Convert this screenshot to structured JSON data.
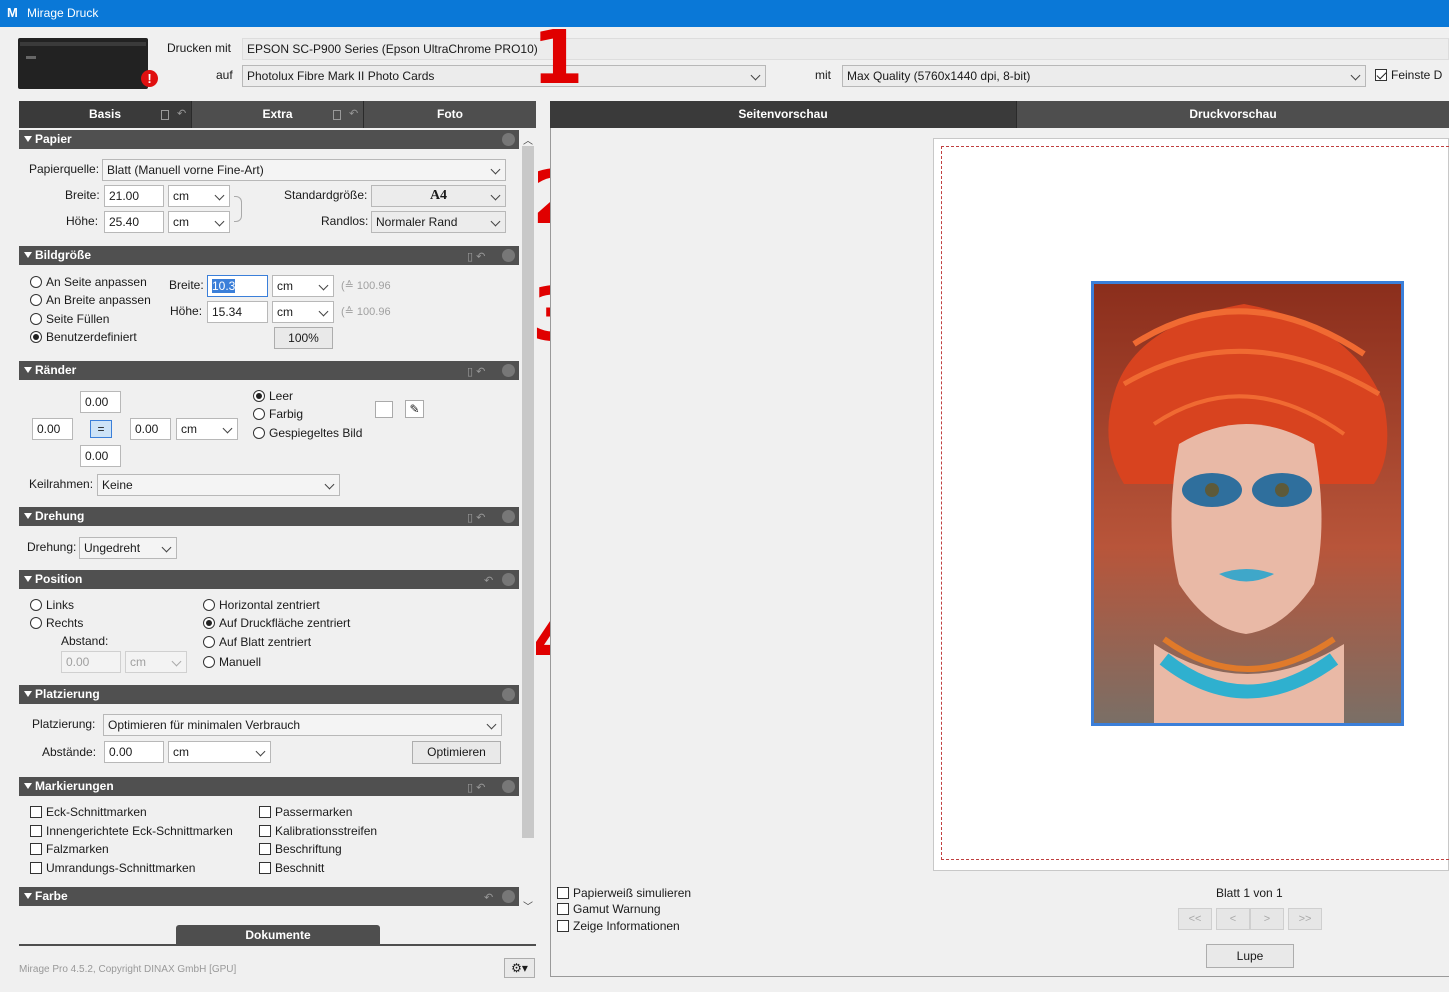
{
  "window": {
    "logo": "M",
    "title": "Mirage Druck"
  },
  "top": {
    "drucken_mit_label": "Drucken mit",
    "printer": "EPSON SC-P900 Series (Epson UltraChrome PRO10)",
    "auf_label": "auf",
    "media": "Photolux Fibre Mark II Photo Cards",
    "mit_label": "mit",
    "quality": "Max Quality (5760x1440 dpi, 8-bit)",
    "feinste_label": "Feinste D",
    "feinste_checked": true,
    "warning_icon": "exclamation-icon"
  },
  "annotations": [
    "1",
    "2",
    "3",
    "4"
  ],
  "left_tabs": [
    "Basis",
    "Extra",
    "Foto"
  ],
  "right_tabs": [
    "Seitenvorschau",
    "Druckvorschau"
  ],
  "papier": {
    "title": "Papier",
    "quelle_label": "Papierquelle:",
    "quelle": "Blatt (Manuell vorne Fine-Art)",
    "breite_label": "Breite:",
    "breite": "21.00",
    "breite_unit": "cm",
    "hoehe_label": "Höhe:",
    "hoehe": "25.40",
    "hoehe_unit": "cm",
    "standard_label": "Standardgröße:",
    "standard": "A4",
    "randlos_label": "Randlos:",
    "randlos": "Normaler Rand"
  },
  "bildgroesse": {
    "title": "Bildgröße",
    "options": [
      "An Seite anpassen",
      "An Breite anpassen",
      "Seite Füllen",
      "Benutzerdefiniert"
    ],
    "selected": 3,
    "breite_label": "Breite:",
    "breite": "10.3",
    "breite_unit": "cm",
    "breite_dpi": "(≙ 100.96",
    "hoehe_label": "Höhe:",
    "hoehe": "15.34",
    "hoehe_unit": "cm",
    "hoehe_dpi": "(≙ 100.96",
    "percent": "100%"
  },
  "raender": {
    "title": "Ränder",
    "top": "0.00",
    "left": "0.00",
    "right": "0.00",
    "bottom": "0.00",
    "unit": "cm",
    "link": "=",
    "fill_options": [
      "Leer",
      "Farbig",
      "Gespiegeltes Bild"
    ],
    "fill_selected": 0,
    "keilrahmen_label": "Keilrahmen:",
    "keilrahmen": "Keine"
  },
  "drehung": {
    "title": "Drehung",
    "label": "Drehung:",
    "value": "Ungedreht"
  },
  "position": {
    "title": "Position",
    "left_options": [
      "Links",
      "Rechts"
    ],
    "abstand_label": "Abstand:",
    "abstand": "0.00",
    "abstand_unit": "cm",
    "right_options": [
      "Horizontal zentriert",
      "Auf Druckfläche zentriert",
      "Auf Blatt zentriert",
      "Manuell"
    ],
    "right_selected": 1
  },
  "platzierung": {
    "title": "Platzierung",
    "label": "Platzierung:",
    "value": "Optimieren für minimalen Verbrauch",
    "abstaende_label": "Abstände:",
    "abstaende": "0.00",
    "abstaende_unit": "cm",
    "optimieren_button": "Optimieren"
  },
  "markierungen": {
    "title": "Markierungen",
    "left": [
      "Eck-Schnittmarken",
      "Innengerichtete Eck-Schnittmarken",
      "Falzmarken",
      "Umrandungs-Schnittmarken"
    ],
    "right": [
      "Passermarken",
      "Kalibrationsstreifen",
      "Beschriftung",
      "Beschnitt"
    ]
  },
  "farbe": {
    "title": "Farbe"
  },
  "dokumente_tab": "Dokumente",
  "footer": "Mirage Pro 4.5.2, Copyright DINAX GmbH [GPU]",
  "preview_options": [
    "Papierweiß simulieren",
    "Gamut Warnung",
    "Zeige Informationen"
  ],
  "page_info": "Blatt 1 von 1",
  "nav_buttons": [
    "<<",
    "<",
    ">",
    ">>"
  ],
  "lupe_button": "Lupe"
}
